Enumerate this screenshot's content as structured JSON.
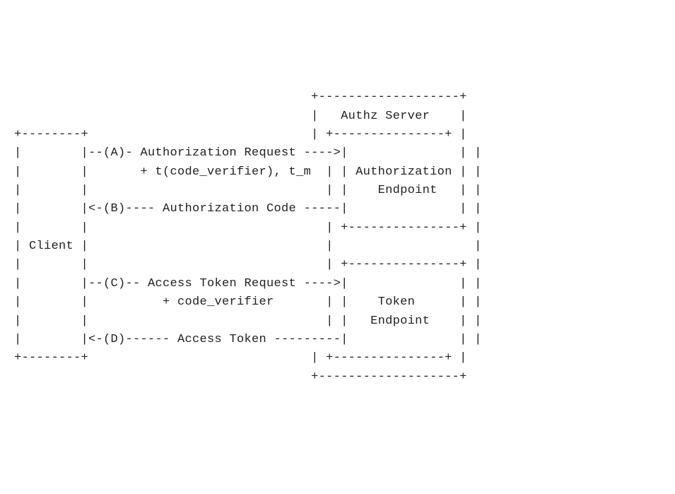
{
  "diagram": {
    "type": "ascii-protocol-flow",
    "lines": [
      "                                        +-------------------+",
      "                                        |   Authz Server    |",
      "+--------+                              | +---------------+ |",
      "|        |--(A)- Authorization Request ---->|               | |",
      "|        |       + t(code_verifier), t_m  | | Authorization | |",
      "|        |                                | |    Endpoint   | |",
      "|        |<-(B)---- Authorization Code -----|               | |",
      "|        |                                | +---------------+ |",
      "| Client |                                |                   |",
      "|        |                                | +---------------+ |",
      "|        |--(C)-- Access Token Request ---->|               | |",
      "|        |          + code_verifier       | |    Token      | |",
      "|        |                                | |   Endpoint    | |",
      "|        |<-(D)------ Access Token ---------|               | |",
      "+--------+                              | +---------------+ |",
      "                                        +-------------------+"
    ]
  },
  "entities": {
    "client": "Client",
    "server": "Authz Server",
    "authorization_endpoint": "Authorization Endpoint",
    "token_endpoint": "Token Endpoint"
  },
  "flows": [
    {
      "step": "A",
      "direction": "to-server",
      "label": "Authorization Request",
      "params": "+ t(code_verifier), t_m"
    },
    {
      "step": "B",
      "direction": "to-client",
      "label": "Authorization Code",
      "params": ""
    },
    {
      "step": "C",
      "direction": "to-server",
      "label": "Access Token Request",
      "params": "+ code_verifier"
    },
    {
      "step": "D",
      "direction": "to-client",
      "label": "Access Token",
      "params": ""
    }
  ]
}
